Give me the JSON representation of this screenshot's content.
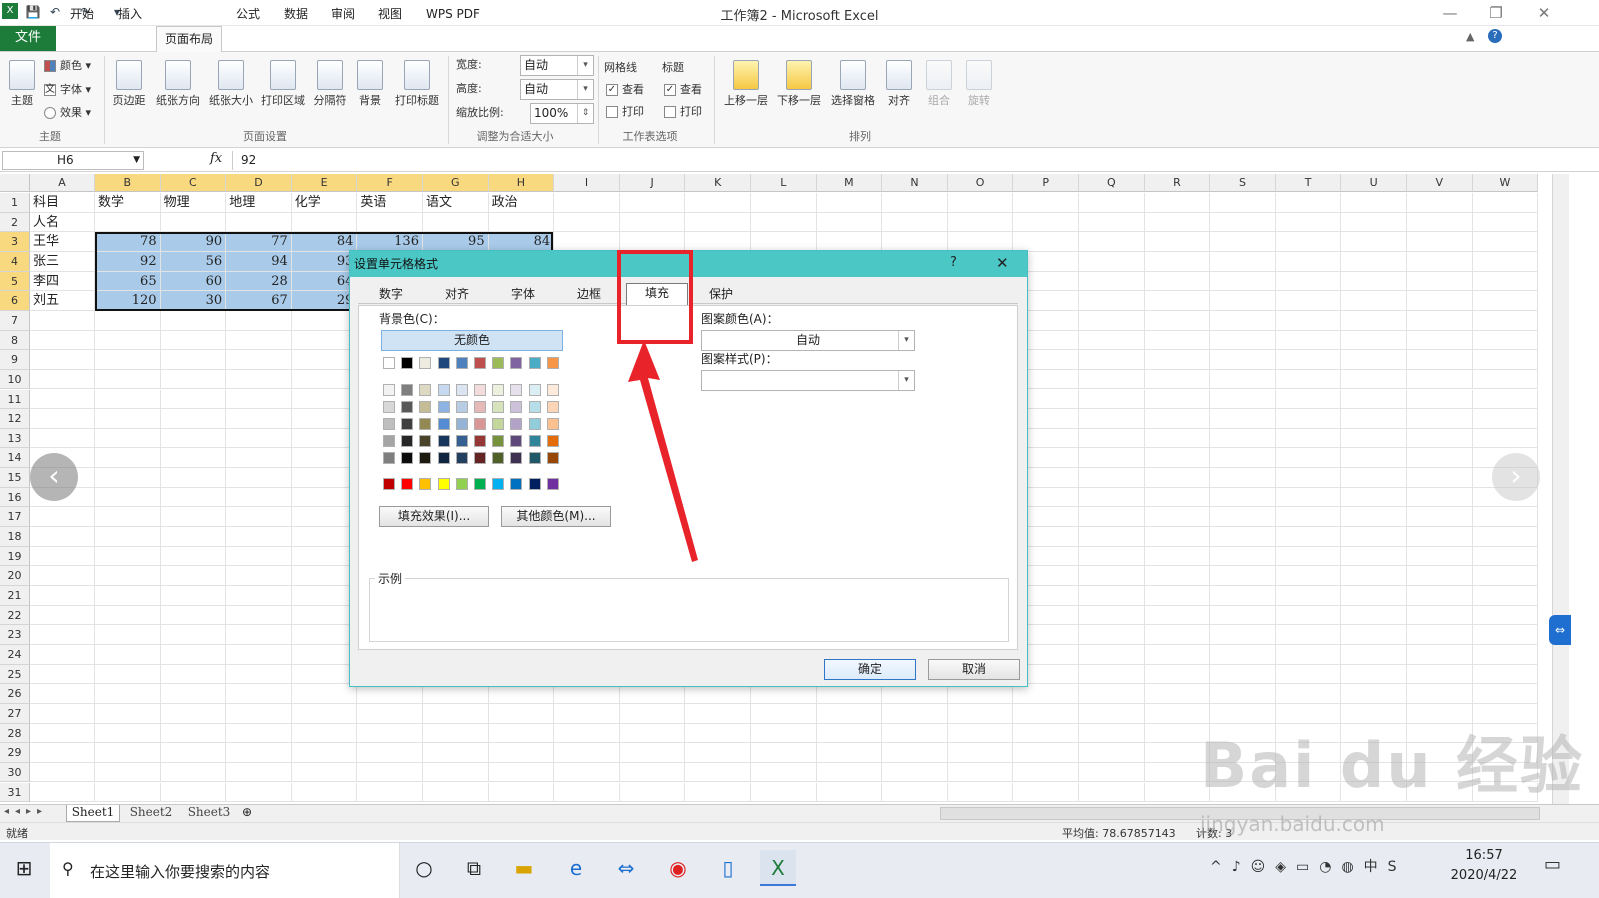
{
  "window": {
    "title": "工作簿2 - Microsoft Excel",
    "controls": [
      "—",
      "❐",
      "✕"
    ]
  },
  "menu": {
    "file": "文件",
    "tabs": [
      "开始",
      "插入",
      "页面布局",
      "公式",
      "数据",
      "审阅",
      "视图",
      "WPS PDF"
    ]
  },
  "ribbon": {
    "theme_group": {
      "theme": "主题",
      "colors": "颜色",
      "fonts": "字体",
      "effects": "效果",
      "label": "主题"
    },
    "page_setup": {
      "buttons": [
        "页边距",
        "纸张方向",
        "纸张大小",
        "打印区域",
        "分隔符",
        "背景",
        "打印标题"
      ],
      "label": "页面设置"
    },
    "scale": {
      "width_label": "宽度:",
      "width_value": "自动",
      "height_label": "高度:",
      "height_value": "自动",
      "zoom_label": "缩放比例:",
      "zoom_value": "100%",
      "label": "调整为合适大小"
    },
    "sheet_options": {
      "gridlines": "网格线",
      "headings": "标题",
      "view": "查看",
      "print": "打印",
      "label": "工作表选项"
    },
    "arrange": {
      "buttons": [
        "上移一层",
        "下移一层",
        "选择窗格",
        "对齐",
        "组合",
        "旋转"
      ],
      "label": "排列"
    }
  },
  "formula_bar": {
    "name_box": "H6",
    "fx": "fx",
    "value": "92"
  },
  "sheet": {
    "columns": [
      "A",
      "B",
      "C",
      "D",
      "E",
      "F",
      "G",
      "H",
      "I",
      "J",
      "K",
      "L",
      "M",
      "N",
      "O",
      "P",
      "Q",
      "R",
      "S",
      "T",
      "U",
      "V",
      "W"
    ],
    "rows": [
      "1",
      "2",
      "3",
      "4",
      "5",
      "6",
      "7",
      "8",
      "9",
      "10",
      "11",
      "12",
      "13",
      "14",
      "15",
      "16",
      "17",
      "18",
      "19",
      "20",
      "21",
      "22",
      "23",
      "24",
      "25",
      "26",
      "27",
      "28",
      "29",
      "30",
      "31"
    ],
    "header_row": [
      "科目",
      "数学",
      "物理",
      "地理",
      "化学",
      "英语",
      "语文",
      "政治"
    ],
    "row2": "人名",
    "names": [
      "王华",
      "张三",
      "李四",
      "刘五"
    ],
    "values": [
      [
        "78",
        "90",
        "77",
        "84",
        "136",
        "95",
        "84"
      ],
      [
        "92",
        "56",
        "94",
        "93",
        "",
        "",
        ""
      ],
      [
        "65",
        "60",
        "28",
        "64",
        "",
        "",
        ""
      ],
      [
        "120",
        "30",
        "67",
        "29",
        "",
        "",
        ""
      ]
    ]
  },
  "sheet_tabs": [
    "Sheet1",
    "Sheet2",
    "Sheet3"
  ],
  "status": {
    "ready": "就绪",
    "average": "平均值: 78.67857143",
    "count": "计数: 3"
  },
  "dialog": {
    "title": "设置单元格格式",
    "help": "?",
    "close": "✕",
    "tabs": [
      "数字",
      "对齐",
      "字体",
      "边框",
      "填充",
      "保护"
    ],
    "bg_color_label": "背景色(C)：",
    "no_color": "无颜色",
    "pattern_color_label": "图案颜色(A)：",
    "pattern_color_value": "自动",
    "pattern_style_label": "图案样式(P)：",
    "fill_effects": "填充效果(I)...",
    "more_colors": "其他颜色(M)...",
    "sample": "示例",
    "ok": "确定",
    "cancel": "取消",
    "row1_colors": [
      "#ffffff",
      "#000000",
      "#eeece1",
      "#1f497d",
      "#4f81bd",
      "#c0504d",
      "#9bbb59",
      "#8064a2",
      "#4bacc6",
      "#f79646"
    ],
    "tint_colors": [
      [
        "#f2f2f2",
        "#7f7f7f",
        "#ddd9c3",
        "#c6d9f0",
        "#dbe5f1",
        "#f2dcdb",
        "#ebf1dd",
        "#e5e0ec",
        "#dbeef3",
        "#fdeada"
      ],
      [
        "#d8d8d8",
        "#595959",
        "#c4bd97",
        "#8db3e2",
        "#b8cce4",
        "#e5b9b7",
        "#d7e3bc",
        "#ccc1d9",
        "#b7dde8",
        "#fbd5b5"
      ],
      [
        "#bfbfbf",
        "#3f3f3f",
        "#938953",
        "#548dd4",
        "#95b3d7",
        "#d99694",
        "#c3d69b",
        "#b2a2c7",
        "#92cddc",
        "#fac08f"
      ],
      [
        "#a5a5a5",
        "#262626",
        "#494429",
        "#17365d",
        "#366092",
        "#953734",
        "#76923c",
        "#5f497a",
        "#31859b",
        "#e36c09"
      ],
      [
        "#7f7f7f",
        "#0c0c0c",
        "#1d1b10",
        "#0f243e",
        "#244061",
        "#632423",
        "#4f6128",
        "#3f3151",
        "#205867",
        "#974806"
      ]
    ],
    "standard_colors": [
      "#c00000",
      "#ff0000",
      "#ffc000",
      "#ffff00",
      "#92d050",
      "#00b050",
      "#00b0f0",
      "#0070c0",
      "#002060",
      "#7030a0"
    ]
  },
  "taskbar": {
    "search": "在这里输入你要搜索的内容",
    "time": "16:57",
    "date": "2020/4/22"
  },
  "watermark": {
    "logo": "Bai du 经验",
    "url": "jingyan.baidu.com"
  },
  "annotation": {
    "color": "#e8232a"
  }
}
